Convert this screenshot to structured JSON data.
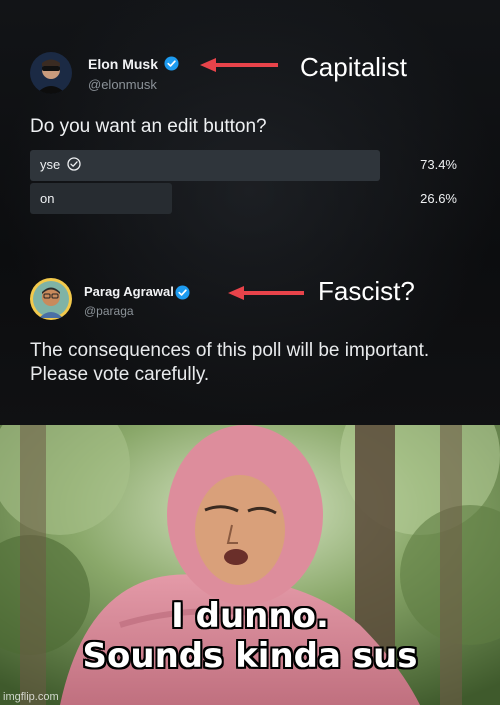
{
  "tweet1": {
    "name": "Elon Musk",
    "handle": "@elonmusk",
    "question": "Do you want an edit button?",
    "options": [
      {
        "label": "yse",
        "percent_text": "73.4%",
        "percent": 73.4,
        "checked": true
      },
      {
        "label": "on",
        "percent_text": "26.6%",
        "percent": 26.6,
        "checked": false
      }
    ],
    "annotation": "Capitalist"
  },
  "tweet2": {
    "name": "Parag Agrawal",
    "handle": "@paraga",
    "line1": "The consequences of this poll will be important.",
    "line2": "Please vote carefully.",
    "annotation": "Fascist?"
  },
  "bottom": {
    "caption_line1": "I dunno.",
    "caption_line2": "Sounds kinda sus"
  },
  "watermark": "imgflip.com",
  "colors": {
    "arrow": "#e8434a",
    "verified": "#1d9bf0",
    "poll_bar_winner": "#2f353b",
    "poll_bar_loser": "#272c31"
  }
}
